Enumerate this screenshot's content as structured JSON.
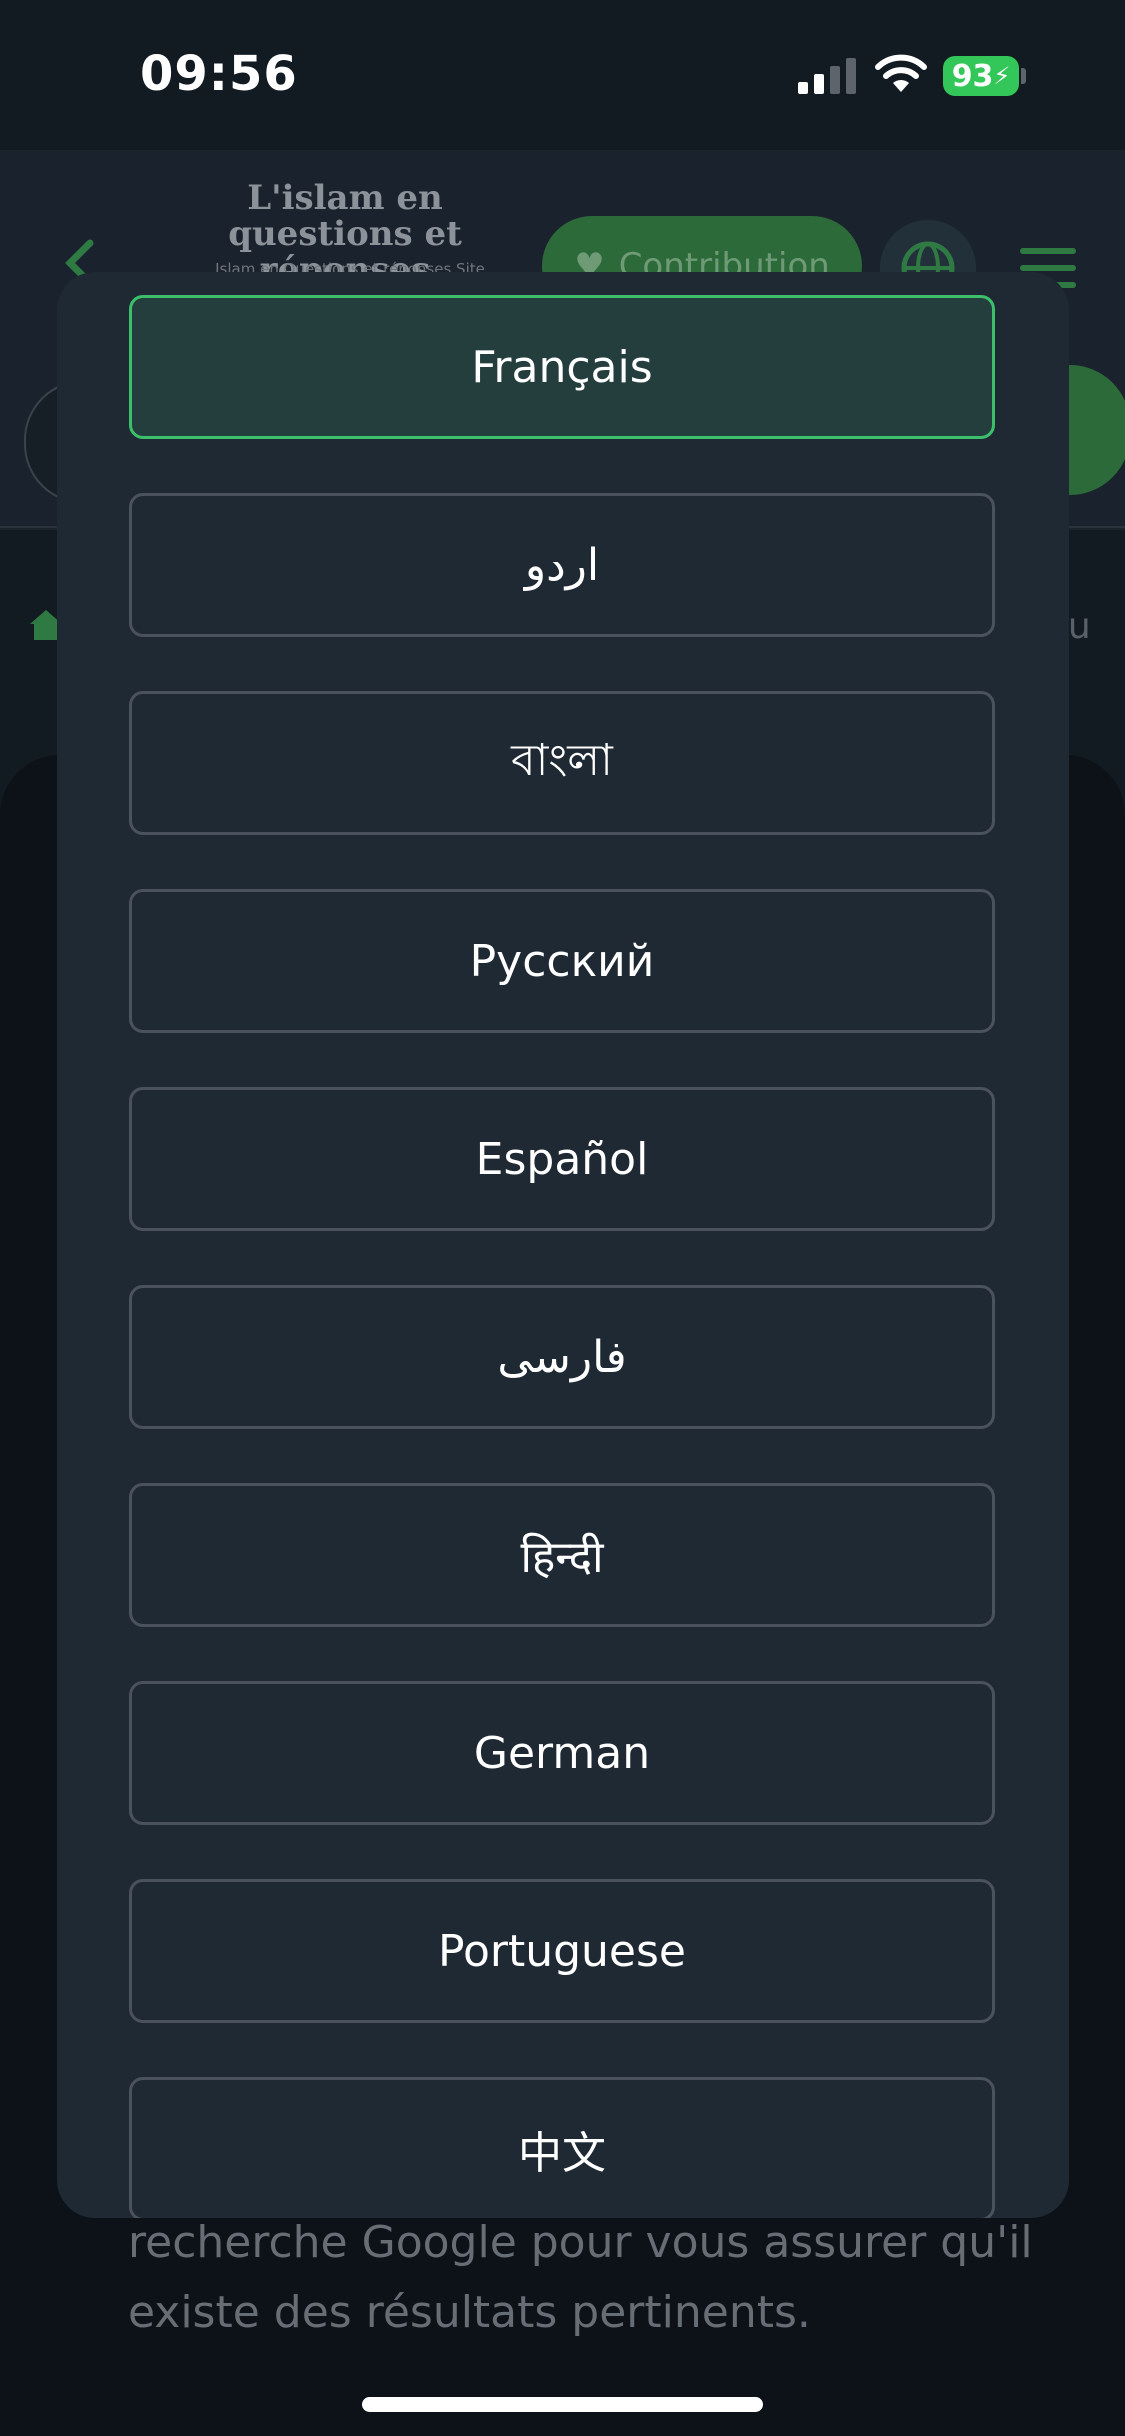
{
  "status_bar": {
    "time": "09:56",
    "battery": "93",
    "icons": [
      "signal-icon",
      "wifi-icon",
      "battery-charging-icon"
    ]
  },
  "background_page": {
    "logo_title": "L'islam en questions et réponses",
    "logo_subtitle": "Islam en Questions et réponses Site",
    "contribution_label": "Contribution",
    "breadcrumb_text": "qu",
    "body_text": "recherche Google pour vous assurer qu'il existe des résultats pertinents.",
    "icons": [
      "back-chevron-icon",
      "heart-hand-icon",
      "globe-icon",
      "menu-icon",
      "home-icon"
    ]
  },
  "language_modal": {
    "selected": "Français",
    "options": [
      "Français",
      "اردو",
      "বাংলা",
      "Русский",
      "Español",
      "فارسی",
      "हिन्दी",
      "German",
      "Portuguese",
      "中文"
    ]
  },
  "colors": {
    "accent_green": "#3cbf6a",
    "modal_bg": "#1f2933",
    "selected_bg": "#243e3e",
    "option_border": "#4a535d"
  }
}
